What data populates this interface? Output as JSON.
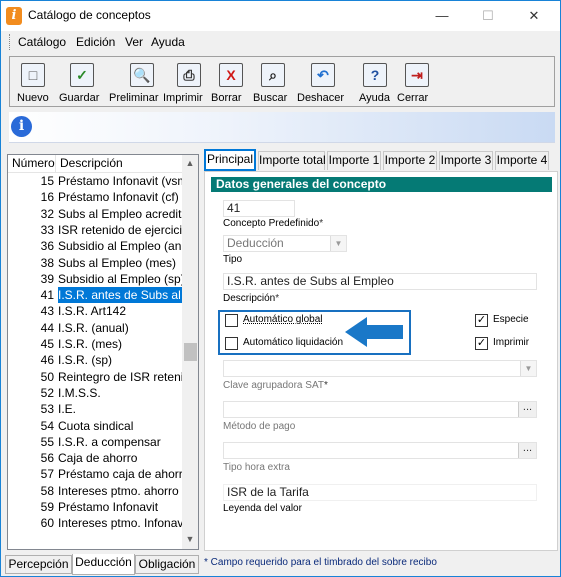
{
  "window": {
    "title": "Catálogo de conceptos",
    "min": "—",
    "max": "☐",
    "close": "✕"
  },
  "menu": [
    "Catálogo",
    "Edición",
    "Ver",
    "Ayuda"
  ],
  "toolbar": [
    {
      "label": "Nuevo",
      "glyph": "□",
      "icon": "new-icon",
      "color": "#555"
    },
    {
      "label": "Guardar",
      "glyph": "✓",
      "icon": "save-icon",
      "color": "#2a8a2a"
    },
    {
      "label": "Preliminar",
      "glyph": "🔍",
      "icon": "preview-icon",
      "color": "#444"
    },
    {
      "label": "Imprimir",
      "glyph": "⎙",
      "icon": "print-icon",
      "color": "#333"
    },
    {
      "label": "Borrar",
      "glyph": "X",
      "icon": "delete-icon",
      "color": "#d01818"
    },
    {
      "label": "Buscar",
      "glyph": "⌕",
      "icon": "binoculars-icon",
      "color": "#222"
    },
    {
      "label": "Deshacer",
      "glyph": "↶",
      "icon": "undo-icon",
      "color": "#1f6fd0"
    },
    {
      "label": "Ayuda",
      "glyph": "?",
      "icon": "help-icon",
      "color": "#1f4fa0"
    },
    {
      "label": "Cerrar",
      "glyph": "⇥",
      "icon": "close-door-icon",
      "color": "#c02020"
    }
  ],
  "list": {
    "headers": {
      "number": "Número",
      "description": "Descripción"
    },
    "rows": [
      {
        "num": "15",
        "desc": "Préstamo Infonavit (vsm)"
      },
      {
        "num": "16",
        "desc": "Préstamo Infonavit (cf)"
      },
      {
        "num": "32",
        "desc": "Subs al Empleo acreditado"
      },
      {
        "num": "33",
        "desc": "ISR retenido de ejercicio anterior"
      },
      {
        "num": "36",
        "desc": "Subsidio al Empleo (anual)"
      },
      {
        "num": "38",
        "desc": "Subs al Empleo (mes)"
      },
      {
        "num": "39",
        "desc": "Subsidio al Empleo (sp)"
      },
      {
        "num": "41",
        "desc": "I.S.R. antes de Subs al Empleo",
        "selected": true
      },
      {
        "num": "43",
        "desc": "I.S.R. Art142"
      },
      {
        "num": "44",
        "desc": "I.S.R. (anual)"
      },
      {
        "num": "45",
        "desc": "I.S.R. (mes)"
      },
      {
        "num": "46",
        "desc": "I.S.R. (sp)"
      },
      {
        "num": "50",
        "desc": "Reintegro de ISR retenido"
      },
      {
        "num": "52",
        "desc": "I.M.S.S."
      },
      {
        "num": "53",
        "desc": "I.E."
      },
      {
        "num": "54",
        "desc": "Cuota sindical"
      },
      {
        "num": "55",
        "desc": "I.S.R. a compensar"
      },
      {
        "num": "56",
        "desc": "Caja de ahorro"
      },
      {
        "num": "57",
        "desc": "Préstamo caja de ahorro"
      },
      {
        "num": "58",
        "desc": "Intereses ptmo. ahorro"
      },
      {
        "num": "59",
        "desc": "Préstamo Infonavit"
      },
      {
        "num": "60",
        "desc": "Intereses ptmo. Infonavit"
      }
    ],
    "scroll_up": "▲",
    "scroll_down": "▼"
  },
  "bottom_tabs": [
    {
      "label": "Percepción",
      "active": false
    },
    {
      "label": "Deducción",
      "active": true
    },
    {
      "label": "Obligación",
      "active": false
    }
  ],
  "tabs": [
    "Principal",
    "Importe total",
    "Importe 1",
    "Importe 2",
    "Importe 3",
    "Importe 4"
  ],
  "form": {
    "section_title": "Datos generales del concepto",
    "concept_number": "41",
    "predefined_label": "Concepto Predefinido",
    "type_value": "Deducción",
    "type_label": "Tipo",
    "description_value": "I.S.R. antes de Subs al Empleo",
    "description_label": "Descripción",
    "auto_global_label": "Automático global",
    "auto_liq_label": "Automático liquidación",
    "especie_label": "Especie",
    "imprimir_label": "Imprimir",
    "sat_label": "Clave agrupadora SAT",
    "payment_label": "Método de pago",
    "overtime_label": "Tipo hora extra",
    "legend_value": "ISR de la Tarifa",
    "legend_label": "Leyenda del valor",
    "required_mark": "*",
    "ellipsis": "...",
    "check_mark": "✓",
    "accent_arrow_color": "#1a78c8"
  },
  "footnote": "* Campo requerido para el timbrado del sobre recibo"
}
